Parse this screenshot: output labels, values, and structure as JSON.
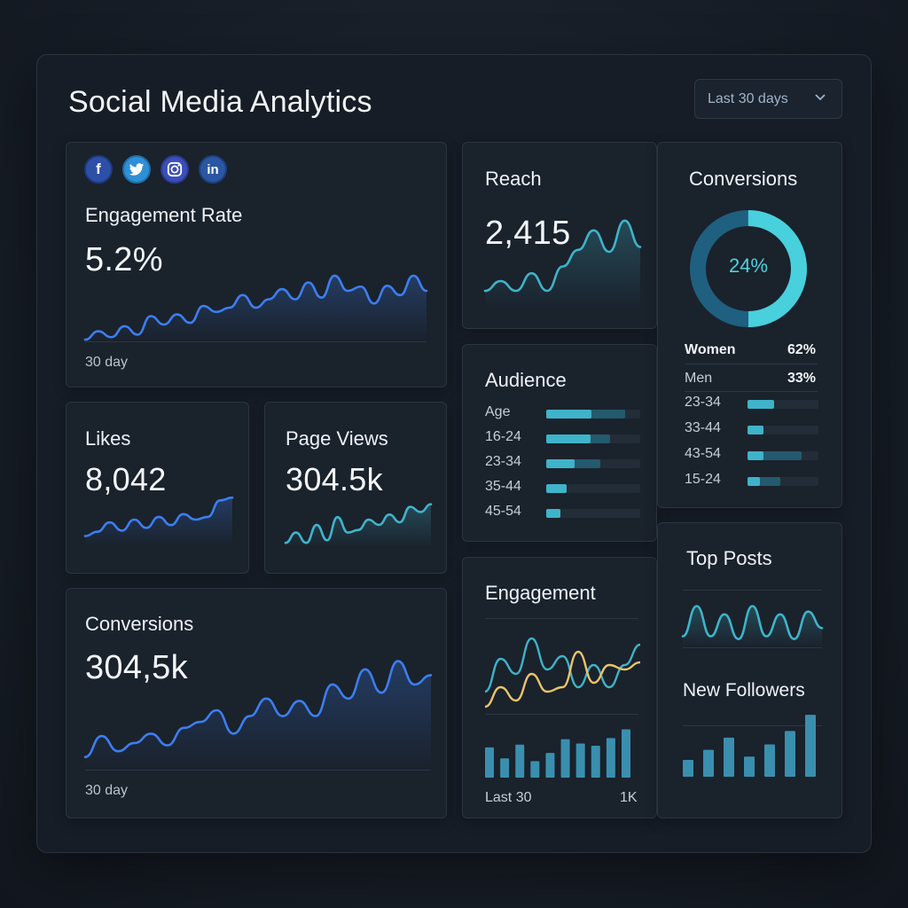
{
  "header": {
    "title": "Social Media Analytics",
    "range_label": "Last 30 days"
  },
  "engagement_rate": {
    "socials": [
      "facebook-icon",
      "twitter-icon",
      "instagram-icon",
      "linkedin-icon"
    ],
    "label": "Engagement Rate",
    "value": "5.2%",
    "period": "30 day"
  },
  "likes": {
    "label": "Likes",
    "value": "8,042"
  },
  "page_views": {
    "label": "Page Views",
    "value": "304.5k"
  },
  "conversions_card": {
    "label": "Conversions",
    "value": "304,5k",
    "period": "30 day"
  },
  "reach": {
    "label": "Reach",
    "value": "2,415"
  },
  "audience": {
    "label": "Audience",
    "rows": [
      {
        "label": "Age",
        "fill": 0.48,
        "mid": 0.84
      },
      {
        "label": "16-24",
        "fill": 0.47,
        "mid": 0.68
      },
      {
        "label": "23-34",
        "fill": 0.3,
        "mid": 0.58
      },
      {
        "label": "35-44",
        "fill": 0.22,
        "mid": 0.22
      },
      {
        "label": "45-54",
        "fill": 0.15,
        "mid": 0.15
      }
    ]
  },
  "conversions_panel": {
    "label": "Conversions",
    "percent": "24%",
    "percent_value": 0.24,
    "women_label": "Women",
    "women_value": "62%",
    "men_label": "Men",
    "men_value": "33%",
    "rows": [
      {
        "label": "23-34",
        "fill": 0.38
      },
      {
        "label": "33-44",
        "fill": 0.22
      },
      {
        "label": "43-54",
        "fill": 0.22,
        "mid": 0.76
      },
      {
        "label": "15-24",
        "fill": 0.18,
        "mid": 0.46
      }
    ]
  },
  "engagement": {
    "label": "Engagement",
    "footer_left": "Last 30",
    "footer_right": "1K"
  },
  "top_posts": {
    "label": "Top Posts"
  },
  "new_followers": {
    "label": "New Followers"
  },
  "colors": {
    "blue": "#3d7ef0",
    "teal": "#3fb3c9",
    "yellow": "#e9c46a",
    "bar": "#3a8fae"
  }
}
